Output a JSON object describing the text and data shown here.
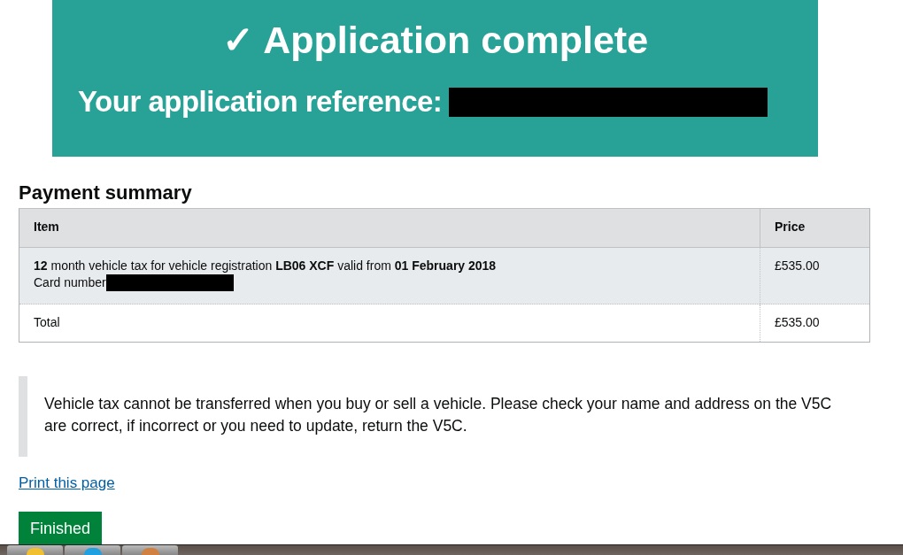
{
  "banner": {
    "title": "✓ Application complete",
    "reference_label": "Your application reference:"
  },
  "payment_summary": {
    "heading": "Payment summary",
    "columns": [
      "Item",
      "Price"
    ],
    "rows": [
      {
        "item": "**12** month vehicle tax for vehicle registration **LB06 XCF** valid from **01 February 2018**",
        "card_label": "Card number",
        "price": "£535.00"
      }
    ],
    "total": {
      "label": "Total",
      "price": "£535.00"
    }
  },
  "notice": "Vehicle tax cannot be transferred when you buy or sell a vehicle. Please check your name and address on the V5C are correct, if incorrect or you need to update, return the V5C.",
  "print_link": "Print this page",
  "finish_button": "Finished"
}
